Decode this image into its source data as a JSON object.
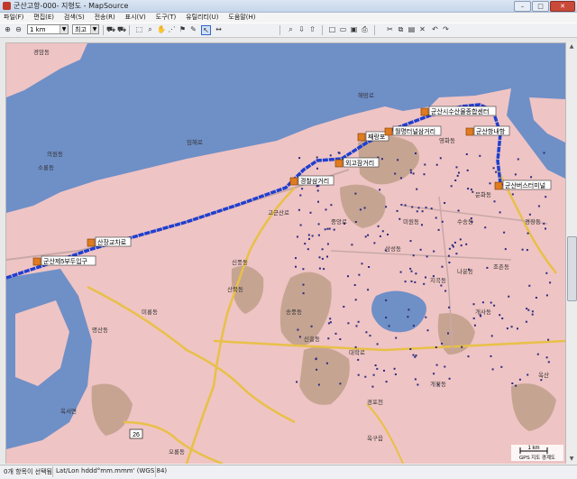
{
  "window": {
    "title": "군산고항-000- 지형도 - MapSource",
    "minimize": "–",
    "maximize": "□",
    "close": "✕"
  },
  "menu": [
    "파일(F)",
    "편집(E)",
    "검색(S)",
    "전송(R)",
    "표시(V)",
    "도구(T)",
    "유틸리티(U)",
    "도움말(H)"
  ],
  "toolbar": {
    "scale_value": "1 km",
    "detail_value": "최고"
  },
  "map": {
    "colors": {
      "sea": "#6f8fc7",
      "land": "#efc4c4",
      "road_major": "#e8c048",
      "road_minor": "#c8a8a8",
      "route": "#1f3fd0",
      "hill": "#b99a82",
      "forest": "#9ab48f"
    },
    "callouts": [
      {
        "text": "군산시수산물종합센터"
      },
      {
        "text": "째랑포"
      },
      {
        "text": "월명터널삼거리"
      },
      {
        "text": "군산항내항"
      },
      {
        "text": "외고잠거리"
      },
      {
        "text": "경찰삼거리"
      },
      {
        "text": "군산버스터미널"
      },
      {
        "text": "산장교차로"
      },
      {
        "text": "군산제5부두입구"
      }
    ],
    "place_labels": [
      "경암동",
      "명산동",
      "영화동",
      "중앙로",
      "임해로",
      "미룡동",
      "신풍동",
      "나운동",
      "삼성동",
      "송풍동",
      "옥구읍",
      "옥산",
      "신흥동",
      "오룡동",
      "개정동",
      "고군산로",
      "대학로",
      "해망로",
      "의원동",
      "소룡동",
      "수송동",
      "조촌동",
      "경장동",
      "미원동",
      "문화동",
      "산북동",
      "지곡동",
      "개사동",
      "경포천",
      "옥서면"
    ],
    "road_number": "26",
    "scale_label": "1 km"
  },
  "status": {
    "selection": "0개 항목이 선택됨",
    "coords": "Lat/Lon hddd°mm.mmm' (WGS 84)",
    "map_name": "GPS 지도 경계도"
  }
}
